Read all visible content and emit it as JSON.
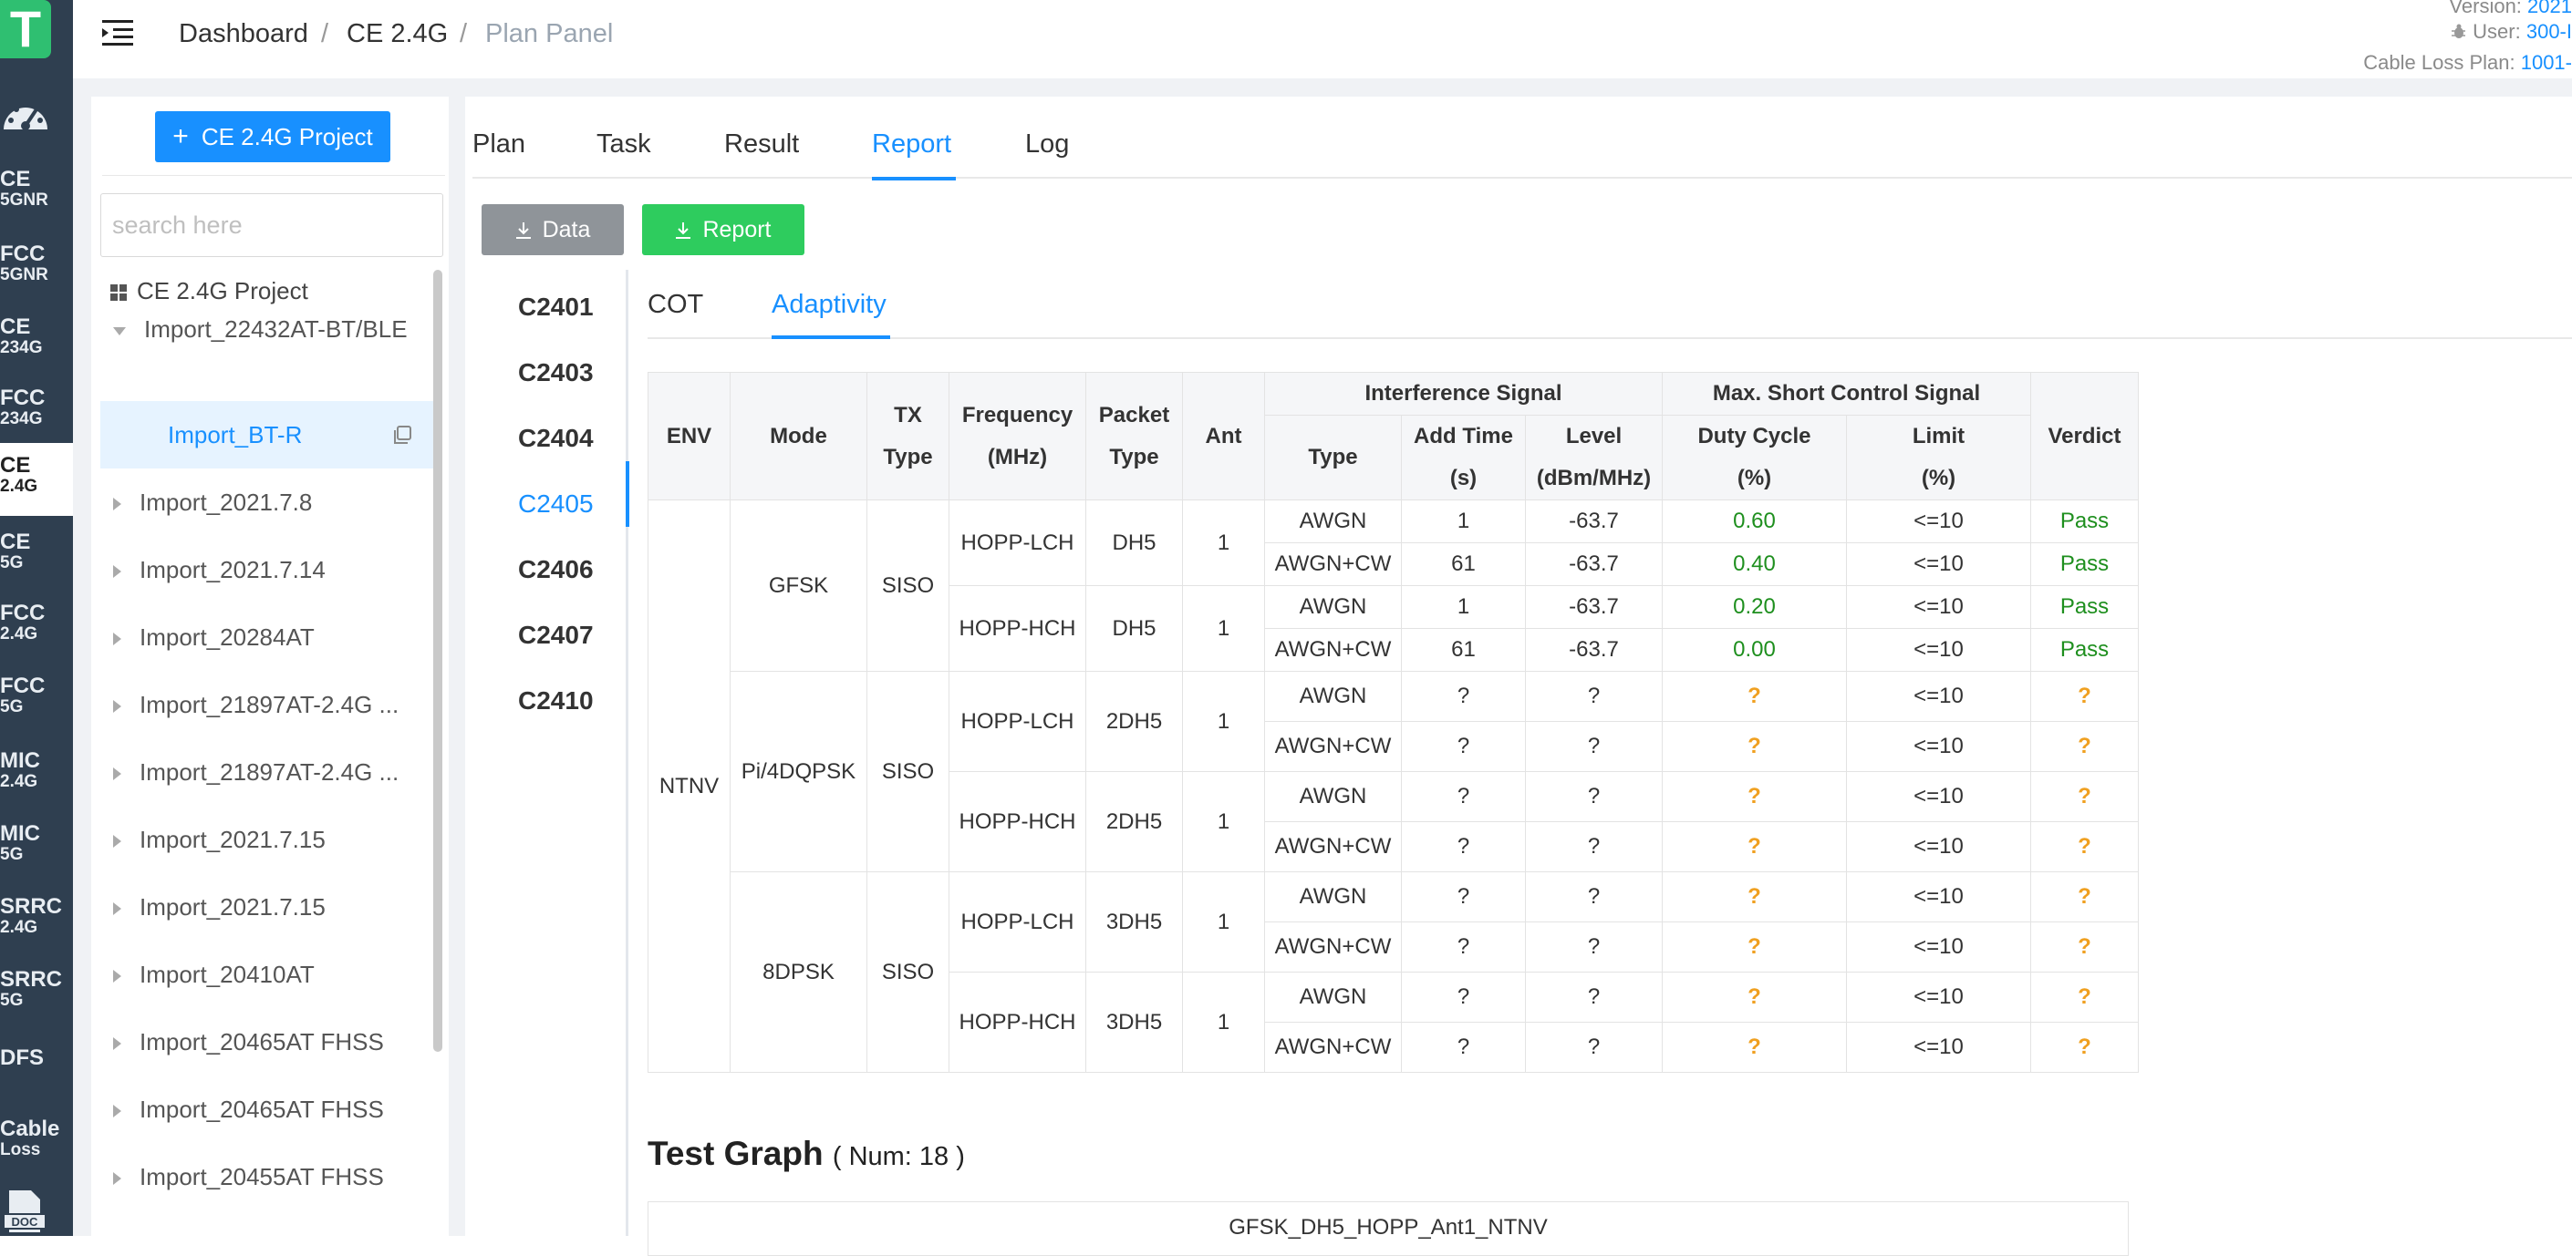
{
  "app": {
    "logo_letter": "T"
  },
  "rail": {
    "items": [
      {
        "l1": "CE",
        "l2": "5GNR"
      },
      {
        "l1": "FCC",
        "l2": "5GNR"
      },
      {
        "l1": "CE",
        "l2": "234G"
      },
      {
        "l1": "FCC",
        "l2": "234G"
      },
      {
        "l1": "CE",
        "l2": "2.4G"
      },
      {
        "l1": "CE",
        "l2": "5G"
      },
      {
        "l1": "FCC",
        "l2": "2.4G"
      },
      {
        "l1": "FCC",
        "l2": "5G"
      },
      {
        "l1": "MIC",
        "l2": "2.4G"
      },
      {
        "l1": "MIC",
        "l2": "5G"
      },
      {
        "l1": "SRRC",
        "l2": "2.4G"
      },
      {
        "l1": "SRRC",
        "l2": "5G"
      },
      {
        "l1": "DFS",
        "l2": ""
      },
      {
        "l1": "Cable",
        "l2": "Loss"
      }
    ],
    "active_index": 4,
    "doc_label": "DOC"
  },
  "breadcrumb": {
    "items": [
      "Dashboard",
      "CE 2.4G",
      "Plan Panel"
    ],
    "separator": "/"
  },
  "meta": {
    "version_label": "Version:",
    "version_value": "2021",
    "user_label": "User:",
    "user_value": "300-I",
    "cable_label": "Cable Loss Plan:",
    "cable_value": "1001-"
  },
  "sidebar": {
    "new_project_label": "CE 2.4G Project",
    "search_placeholder": "search here",
    "root_label": "CE 2.4G Project",
    "expanded_node": "Import_22432AT-BT/BLE",
    "selected_child": "Import_BT-R",
    "nodes": [
      "Import_2021.7.8",
      "Import_2021.7.14",
      "Import_20284AT",
      "Import_21897AT-2.4G ...",
      "Import_21897AT-2.4G ...",
      "Import_2021.7.15",
      "Import_2021.7.15",
      "Import_20410AT",
      "Import_20465AT FHSS",
      "Import_20465AT FHSS",
      "Import_20455AT FHSS"
    ]
  },
  "main": {
    "tabs": [
      "Plan",
      "Task",
      "Result",
      "Report",
      "Log"
    ],
    "active_tab": "Report",
    "buttons": {
      "data": "Data",
      "report": "Report"
    },
    "side_tabs": [
      "C2401",
      "C2403",
      "C2404",
      "C2405",
      "C2406",
      "C2407",
      "C2410"
    ],
    "active_side_tab": "C2405",
    "sub_tabs": [
      "COT",
      "Adaptivity"
    ],
    "active_sub_tab": "Adaptivity"
  },
  "table": {
    "headers": {
      "env": "ENV",
      "mode": "Mode",
      "tx_type_1": "TX",
      "tx_type_2": "Type",
      "freq_1": "Frequency",
      "freq_2": "(MHz)",
      "packet_1": "Packet",
      "packet_2": "Type",
      "ant": "Ant",
      "interference": "Interference Signal",
      "max_short": "Max. Short Control Signal",
      "verdict": "Verdict",
      "type": "Type",
      "add_time_1": "Add Time",
      "add_time_2": "(s)",
      "level_1": "Level",
      "level_2": "(dBm/MHz)",
      "duty_1": "Duty Cycle",
      "duty_2": "(%)",
      "limit_1": "Limit",
      "limit_2": "(%)"
    },
    "env_value": "NTNV",
    "modes": [
      {
        "mode": "GFSK",
        "tx": "SISO",
        "groups": [
          {
            "freq": "HOPP-LCH",
            "packet": "DH5",
            "ant": "1",
            "rows": [
              {
                "type": "AWGN",
                "add_time": "1",
                "level": "-63.7",
                "duty": "0.60",
                "limit": "<=10",
                "verdict": "Pass"
              },
              {
                "type": "AWGN+CW",
                "add_time": "61",
                "level": "-63.7",
                "duty": "0.40",
                "limit": "<=10",
                "verdict": "Pass"
              }
            ]
          },
          {
            "freq": "HOPP-HCH",
            "packet": "DH5",
            "ant": "1",
            "rows": [
              {
                "type": "AWGN",
                "add_time": "1",
                "level": "-63.7",
                "duty": "0.20",
                "limit": "<=10",
                "verdict": "Pass"
              },
              {
                "type": "AWGN+CW",
                "add_time": "61",
                "level": "-63.7",
                "duty": "0.00",
                "limit": "<=10",
                "verdict": "Pass"
              }
            ]
          }
        ]
      },
      {
        "mode": "Pi/4DQPSK",
        "tx": "SISO",
        "groups": [
          {
            "freq": "HOPP-LCH",
            "packet": "2DH5",
            "ant": "1",
            "rows": [
              {
                "type": "AWGN",
                "add_time": "?",
                "level": "?",
                "duty": "?",
                "limit": "<=10",
                "verdict": "?"
              },
              {
                "type": "AWGN+CW",
                "add_time": "?",
                "level": "?",
                "duty": "?",
                "limit": "<=10",
                "verdict": "?"
              }
            ]
          },
          {
            "freq": "HOPP-HCH",
            "packet": "2DH5",
            "ant": "1",
            "rows": [
              {
                "type": "AWGN",
                "add_time": "?",
                "level": "?",
                "duty": "?",
                "limit": "<=10",
                "verdict": "?"
              },
              {
                "type": "AWGN+CW",
                "add_time": "?",
                "level": "?",
                "duty": "?",
                "limit": "<=10",
                "verdict": "?"
              }
            ]
          }
        ]
      },
      {
        "mode": "8DPSK",
        "tx": "SISO",
        "groups": [
          {
            "freq": "HOPP-LCH",
            "packet": "3DH5",
            "ant": "1",
            "rows": [
              {
                "type": "AWGN",
                "add_time": "?",
                "level": "?",
                "duty": "?",
                "limit": "<=10",
                "verdict": "?"
              },
              {
                "type": "AWGN+CW",
                "add_time": "?",
                "level": "?",
                "duty": "?",
                "limit": "<=10",
                "verdict": "?"
              }
            ]
          },
          {
            "freq": "HOPP-HCH",
            "packet": "3DH5",
            "ant": "1",
            "rows": [
              {
                "type": "AWGN",
                "add_time": "?",
                "level": "?",
                "duty": "?",
                "limit": "<=10",
                "verdict": "?"
              },
              {
                "type": "AWGN+CW",
                "add_time": "?",
                "level": "?",
                "duty": "?",
                "limit": "<=10",
                "verdict": "?"
              }
            ]
          }
        ]
      }
    ]
  },
  "graph": {
    "title": "Test Graph",
    "num": "( Num: 18 )",
    "first_caption": "GFSK_DH5_HOPP_Ant1_NTNV"
  },
  "colors": {
    "accent": "#1890ff",
    "pass": "#1e8f1e",
    "pending": "#f0a020",
    "rail": "#2f3f50",
    "report_button": "#2ecc5e"
  }
}
